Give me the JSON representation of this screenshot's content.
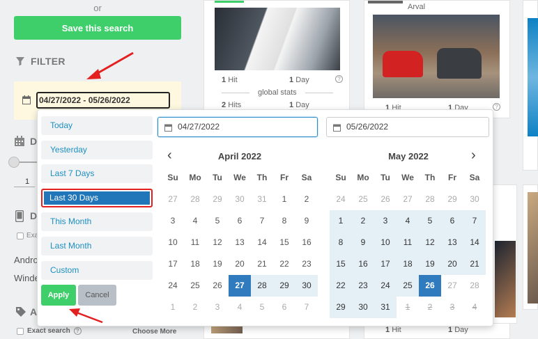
{
  "sidebar": {
    "or_text": "or",
    "save_button": "Save this search",
    "filter_title": "FILTER",
    "date_range_value": "04/27/2022 - 05/26/2022",
    "section2_letter": "D",
    "slider_value": "1",
    "section3_letter": "D",
    "exact_label": "Exa",
    "android_text": "Andro",
    "windows_text": "Winde",
    "section4_letter": "A",
    "exact_search": "Exact search",
    "choose_more": "Choose More"
  },
  "cards": {
    "left": {
      "hits_top": "1",
      "hit_label": "Hit",
      "days_top": "1",
      "day_label": "Day",
      "global_stats": "global stats",
      "hits_bottom": "2",
      "hits_label": "Hits",
      "days_bottom": "1"
    },
    "middle": {
      "top_label": "Arval",
      "hits": "1",
      "hit_label": "Hit",
      "days": "1",
      "day_label": "Day",
      "bottom_hits": "1",
      "bottom_hit_label": "Hit",
      "bottom_days": "1",
      "bottom_day_label": "Day"
    }
  },
  "picker": {
    "presets": [
      {
        "label": "Today",
        "active": false
      },
      {
        "label": "Yesterday",
        "active": false
      },
      {
        "label": "Last 7 Days",
        "active": false
      },
      {
        "label": "Last 30 Days",
        "active": true
      },
      {
        "label": "This Month",
        "active": false
      },
      {
        "label": "Last Month",
        "active": false
      },
      {
        "label": "Custom",
        "active": false
      }
    ],
    "apply": "Apply",
    "cancel": "Cancel",
    "start_date": "04/27/2022",
    "end_date": "05/26/2022",
    "left_month": "April 2022",
    "right_month": "May 2022",
    "weekdays": [
      "Su",
      "Mo",
      "Tu",
      "We",
      "Th",
      "Fr",
      "Sa"
    ],
    "left_days": [
      [
        "27",
        "28",
        "29",
        "30",
        "31",
        "1",
        "2"
      ],
      [
        "3",
        "4",
        "5",
        "6",
        "7",
        "8",
        "9"
      ],
      [
        "10",
        "11",
        "12",
        "13",
        "14",
        "15",
        "16"
      ],
      [
        "17",
        "18",
        "19",
        "20",
        "21",
        "22",
        "23"
      ],
      [
        "24",
        "25",
        "26",
        "27",
        "28",
        "29",
        "30"
      ],
      [
        "1",
        "2",
        "3",
        "4",
        "5",
        "6",
        "7"
      ]
    ],
    "right_days": [
      [
        "24",
        "25",
        "26",
        "27",
        "28",
        "29",
        "30"
      ],
      [
        "1",
        "2",
        "3",
        "4",
        "5",
        "6",
        "7"
      ],
      [
        "8",
        "9",
        "10",
        "11",
        "12",
        "13",
        "14"
      ],
      [
        "15",
        "16",
        "17",
        "18",
        "19",
        "20",
        "21"
      ],
      [
        "22",
        "23",
        "24",
        "25",
        "26",
        "27",
        "28"
      ],
      [
        "29",
        "30",
        "31",
        "1",
        "2",
        "3",
        "4"
      ]
    ]
  },
  "colors": {
    "green": "#3ecf6b",
    "selected": "#2f7bbd",
    "range": "#e5eff6",
    "preset_text": "#1d8fc1",
    "annotation": "#e41f1f"
  }
}
